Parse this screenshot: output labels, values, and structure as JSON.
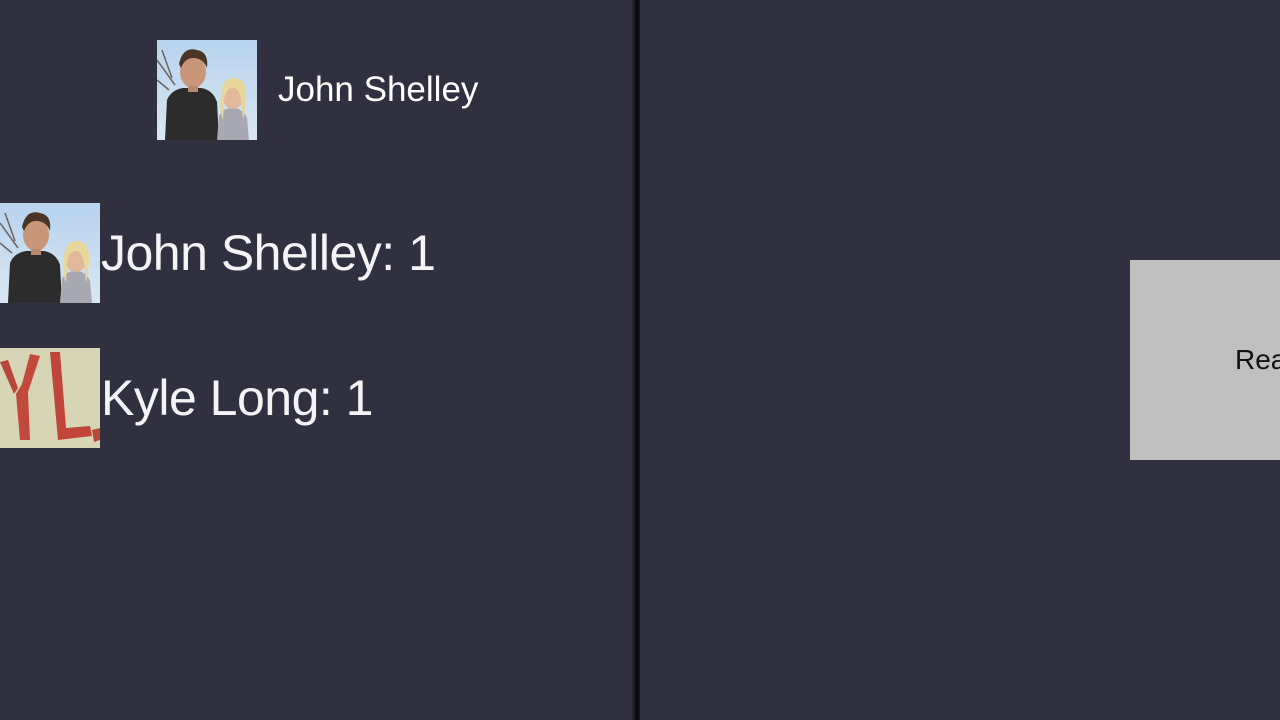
{
  "current_user": {
    "name": "John Shelley",
    "avatar_icon": "profile-photo-couple"
  },
  "scores": [
    {
      "label": "John Shelley: 1",
      "avatar_icon": "profile-photo-couple"
    },
    {
      "label": "Kyle Long: 1",
      "avatar_icon": "profile-photo-yl-letters"
    }
  ],
  "ready_card": {
    "label": "Rea"
  },
  "colors": {
    "background": "#313040",
    "card": "#bfbfbf",
    "text": "#ffffff"
  }
}
